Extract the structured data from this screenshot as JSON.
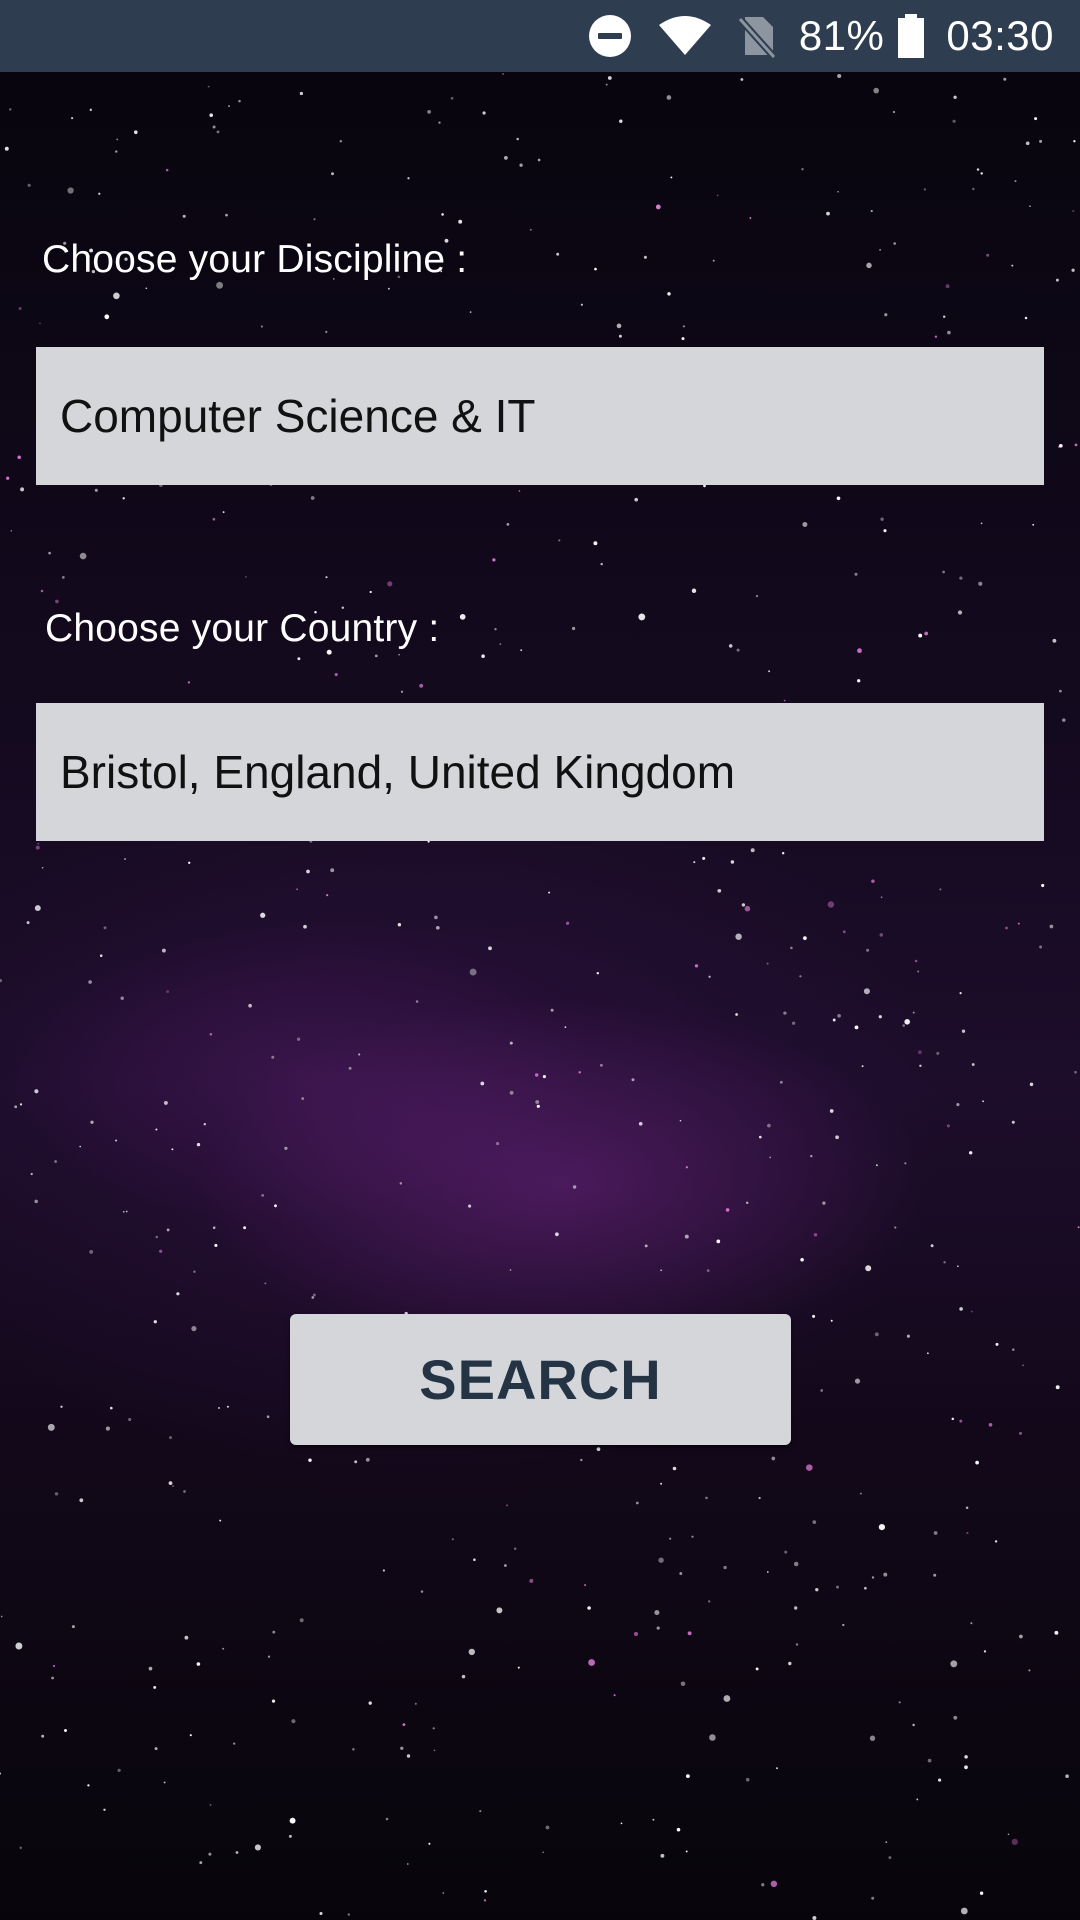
{
  "status_bar": {
    "dnd_icon": "do-not-disturb-icon",
    "wifi_icon": "wifi-icon",
    "sim_icon": "no-sim-icon",
    "battery_percent": "81%",
    "battery_icon": "battery-icon",
    "battery_level": 0.81,
    "time": "03:30",
    "background_color": "#2e3d4f"
  },
  "form": {
    "discipline_label": "Choose your Discipline :",
    "discipline_value": "Computer Science & IT",
    "country_label": "Choose your Country :",
    "country_value": "Bristol, England, United Kingdom",
    "field_background": "#d4d6da"
  },
  "search_button": {
    "label": "SEARCH",
    "text_color": "#243445"
  }
}
